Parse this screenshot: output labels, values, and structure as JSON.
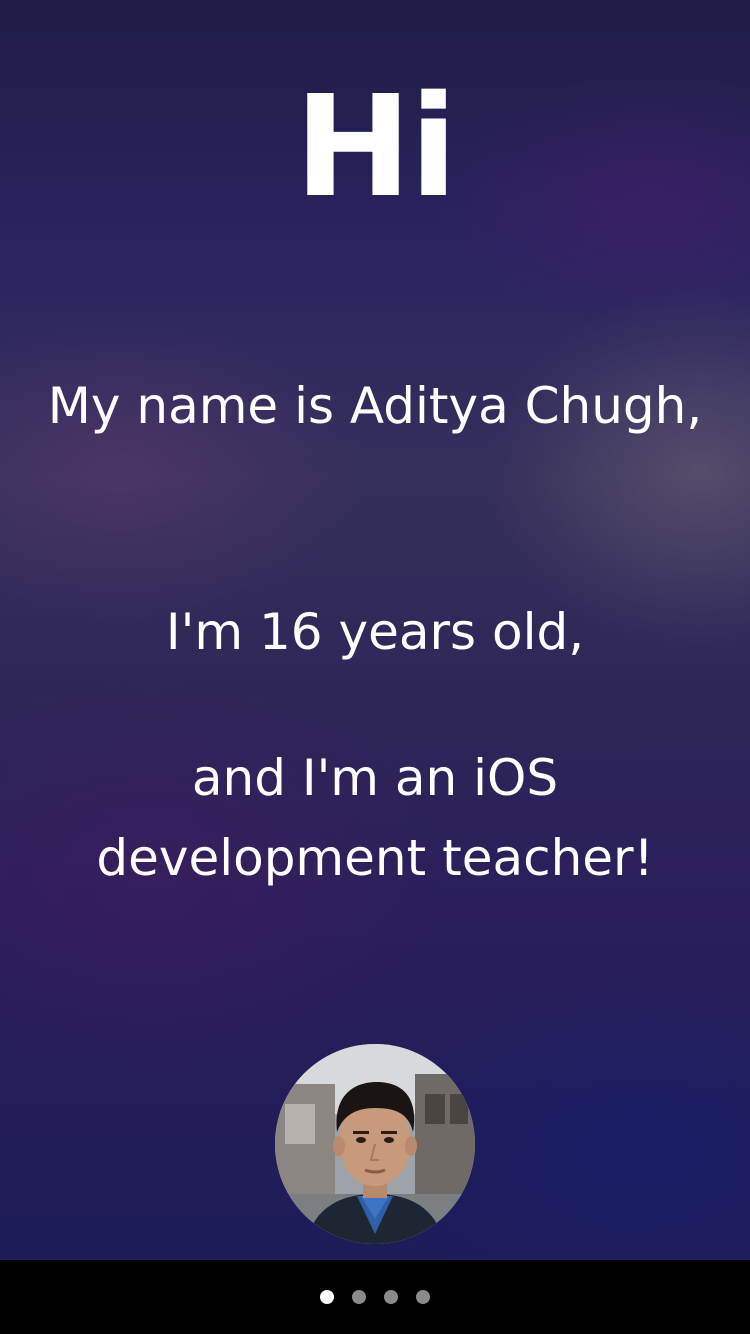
{
  "header": {
    "logo_text": "Hi"
  },
  "intro": {
    "name_line": "My name is Aditya Chugh,",
    "age_line": "I'm 16 years old,",
    "role_line": "and I'm an iOS development teacher!"
  },
  "profile": {
    "photo_icon": "person-photo"
  },
  "page_control": {
    "pages": 4,
    "current_page": 1
  },
  "colors": {
    "background_top": "#1f1d46",
    "background_bottom": "#1d1c58",
    "text": "#ffffff",
    "dot_active": "#ffffff",
    "dot_inactive": "#8a8a8a"
  }
}
